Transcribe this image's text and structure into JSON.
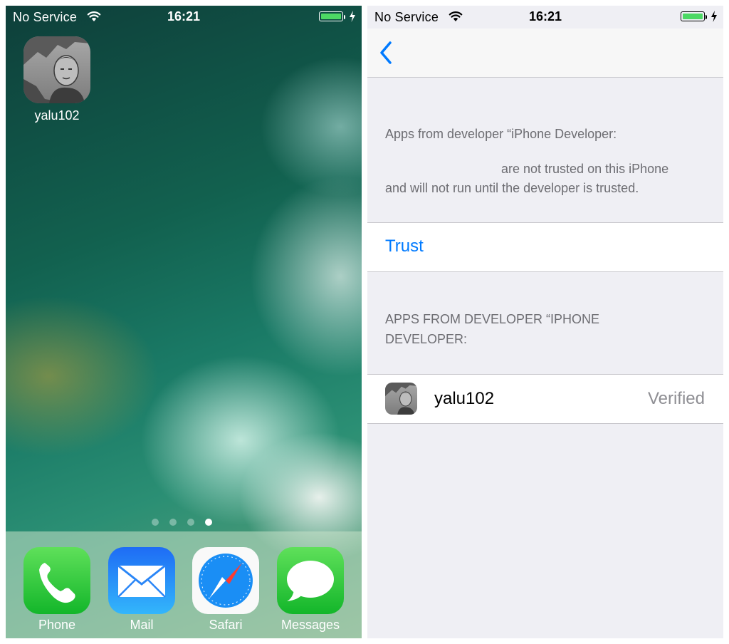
{
  "left_screen": {
    "status_bar": {
      "carrier": "No Service",
      "time": "16:21",
      "battery_percent": 100,
      "charging": true
    },
    "home_app": {
      "label": "yalu102",
      "icon": "developer-portrait-icon"
    },
    "page_dots": {
      "count": 4,
      "active_index": 3
    },
    "dock": [
      {
        "label": "Phone",
        "icon": "phone-icon",
        "color": "#34c759"
      },
      {
        "label": "Mail",
        "icon": "mail-icon",
        "color": "#1a8cff"
      },
      {
        "label": "Safari",
        "icon": "compass-icon",
        "color": "#1e90ff"
      },
      {
        "label": "Messages",
        "icon": "speech-bubble-icon",
        "color": "#34c759"
      }
    ]
  },
  "right_screen": {
    "status_bar": {
      "carrier": "No Service",
      "time": "16:21",
      "battery_percent": 100,
      "charging": true
    },
    "nav": {
      "back_icon": "chevron-left-icon",
      "accent": "#007aff"
    },
    "description_line1": "Apps from developer “iPhone Developer:",
    "description_line2": "are not trusted on this iPhone",
    "description_line3": "and will not run until the developer is trusted.",
    "trust_label": "Trust",
    "section_header_line1": "APPS FROM DEVELOPER “IPHONE",
    "section_header_line2": "DEVELOPER:",
    "app_row": {
      "name": "yalu102",
      "status": "Verified",
      "icon": "developer-portrait-icon"
    }
  }
}
